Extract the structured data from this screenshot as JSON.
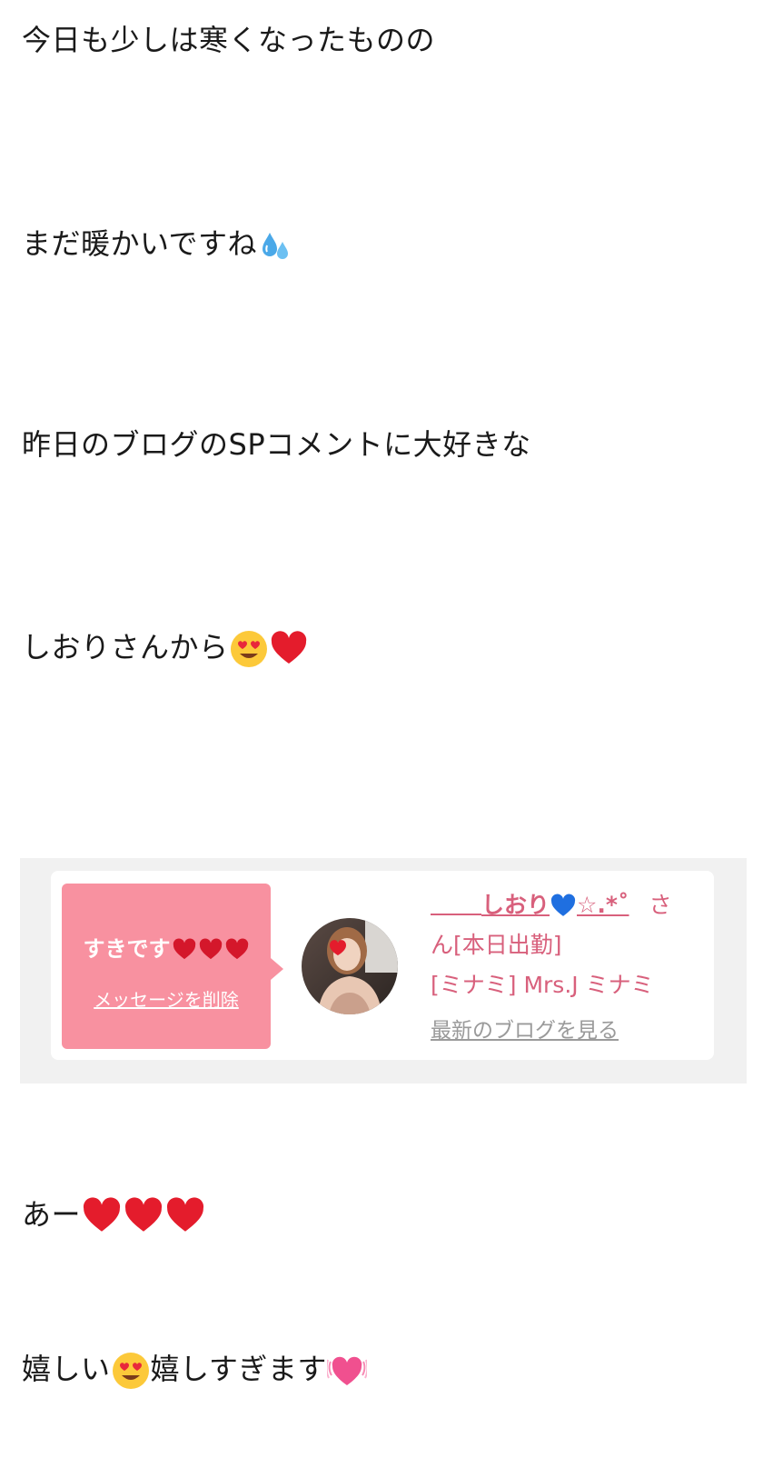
{
  "post": {
    "line1": "今日も少しは寒くなったものの",
    "line2_text": "まだ暖かいですね",
    "line2_emoji": "sweat-droplets-icon",
    "line3": "昨日のブログのSPコメントに大好きな",
    "line4_text": "しおりさんから",
    "line4_emoji": [
      "heart-eyes-icon",
      "red-heart-icon"
    ],
    "line5_text": "あー",
    "line5_emoji": [
      "red-heart-icon",
      "red-heart-icon",
      "red-heart-icon"
    ],
    "line6_text1": "嬉しい",
    "line6_text2": "嬉しすぎます",
    "line6_emoji": [
      "heart-eyes-icon",
      "growing-heart-icon"
    ]
  },
  "comment_card": {
    "message": "すきです",
    "message_emoji": [
      "red-heart-icon",
      "red-heart-icon",
      "red-heart-icon"
    ],
    "delete_label": "メッセージを削除",
    "sender_name": "しおり",
    "sender_name_suffix": "☆.*˚",
    "sender_name_emoji": "blue-heart-icon",
    "honorific": "さ",
    "line2": "ん[本日出勤]",
    "line3": "[ミナミ] Mrs.J ミナミ",
    "latest_blog_link": "最新のブログを見る",
    "colors": {
      "bubble": "#f891a0",
      "link": "#d8607c",
      "card_bg": "#f1f1f1"
    }
  }
}
